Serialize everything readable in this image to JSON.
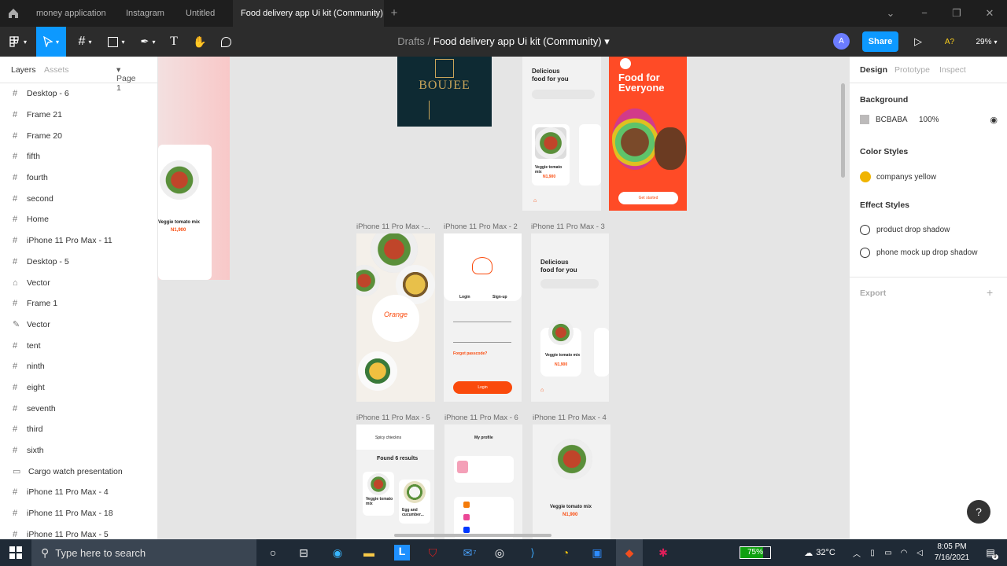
{
  "tabs": {
    "home_icon": "home-icon",
    "items": [
      {
        "label": "money application"
      },
      {
        "label": "Instagram"
      },
      {
        "label": "Untitled"
      },
      {
        "label": "Food delivery app Ui kit (Community)",
        "close": "×"
      }
    ],
    "new_tab": "+"
  },
  "window_controls": {
    "minimize": "⌄",
    "maximize": "−",
    "restore": "❐",
    "close": "✕"
  },
  "toolbar": {
    "breadcrumb_drafts": "Drafts",
    "breadcrumb_sep": "/",
    "file_name": "Food delivery app Ui kit (Community)",
    "avatar_initial": "A",
    "share_label": "Share",
    "play_icon": "▷",
    "missing_fonts": "A?",
    "zoom": "29%"
  },
  "left_panel": {
    "tab_layers": "Layers",
    "tab_assets": "Assets",
    "page": "Page 1",
    "layers": [
      {
        "icon": "#",
        "label": "Desktop - 6"
      },
      {
        "icon": "#",
        "label": "Frame 21"
      },
      {
        "icon": "#",
        "label": "Frame 20"
      },
      {
        "icon": "#",
        "label": "fifth"
      },
      {
        "icon": "#",
        "label": "fourth"
      },
      {
        "icon": "#",
        "label": "second"
      },
      {
        "icon": "#",
        "label": "Home"
      },
      {
        "icon": "#",
        "label": "iPhone 11 Pro Max - 11"
      },
      {
        "icon": "#",
        "label": "Desktop - 5"
      },
      {
        "icon": "⌂",
        "label": "Vector"
      },
      {
        "icon": "#",
        "label": "Frame 1"
      },
      {
        "icon": "✎",
        "label": "Vector"
      },
      {
        "icon": "#",
        "label": "tent"
      },
      {
        "icon": "#",
        "label": "ninth"
      },
      {
        "icon": "#",
        "label": "eight"
      },
      {
        "icon": "#",
        "label": "seventh"
      },
      {
        "icon": "#",
        "label": "third"
      },
      {
        "icon": "#",
        "label": "sixth"
      },
      {
        "icon": "▭",
        "label": "Cargo watch presentation"
      },
      {
        "icon": "#",
        "label": "iPhone 11 Pro Max - 4"
      },
      {
        "icon": "#",
        "label": "iPhone 11 Pro Max - 18"
      },
      {
        "icon": "#",
        "label": "iPhone 11 Pro Max - 5"
      }
    ]
  },
  "canvas": {
    "labels": {
      "f1": "iPhone 11 Pro Max -...",
      "f2": "iPhone 11 Pro Max - 2",
      "f3": "iPhone 11 Pro Max - 3",
      "f5": "iPhone 11 Pro Max - 5",
      "f6": "iPhone 11 Pro Max - 6",
      "f4": "iPhone 11 Pro Max - 4"
    },
    "boujee": "BOUJEE",
    "delicious": "Delicious\nfood for you",
    "food_for_everyone": "Food for Everyone",
    "get_started": "Get started",
    "veggie": "Veggie tomato mix",
    "price": "N1,900",
    "login": "Login",
    "signup": "Sign-up",
    "forgot": "Forgot passcode?",
    "found": "Found  6 results",
    "search_text": "Spicy chieckns",
    "my_profile": "My profile",
    "egg": "Egg and cucumber...",
    "orange": "Orange"
  },
  "right_panel": {
    "tab_design": "Design",
    "tab_prototype": "Prototype",
    "tab_inspect": "Inspect",
    "background_title": "Background",
    "bg_hex": "BCBABA",
    "bg_opacity": "100%",
    "bg_color": "#BCBABA",
    "color_styles_title": "Color Styles",
    "color_style_name": "companys yellow",
    "color_style_color": "#F0B400",
    "effect_styles_title": "Effect Styles",
    "effect_1": "product drop shadow",
    "effect_2": "phone mock up drop shadow",
    "export_title": "Export",
    "export_add": "+"
  },
  "taskbar": {
    "search_placeholder": "Type here to search",
    "battery": "75%",
    "temperature": "32°C",
    "time": "8:05 PM",
    "date": "7/16/2021",
    "notifications": "9",
    "mail_badge": "7"
  },
  "help": "?"
}
